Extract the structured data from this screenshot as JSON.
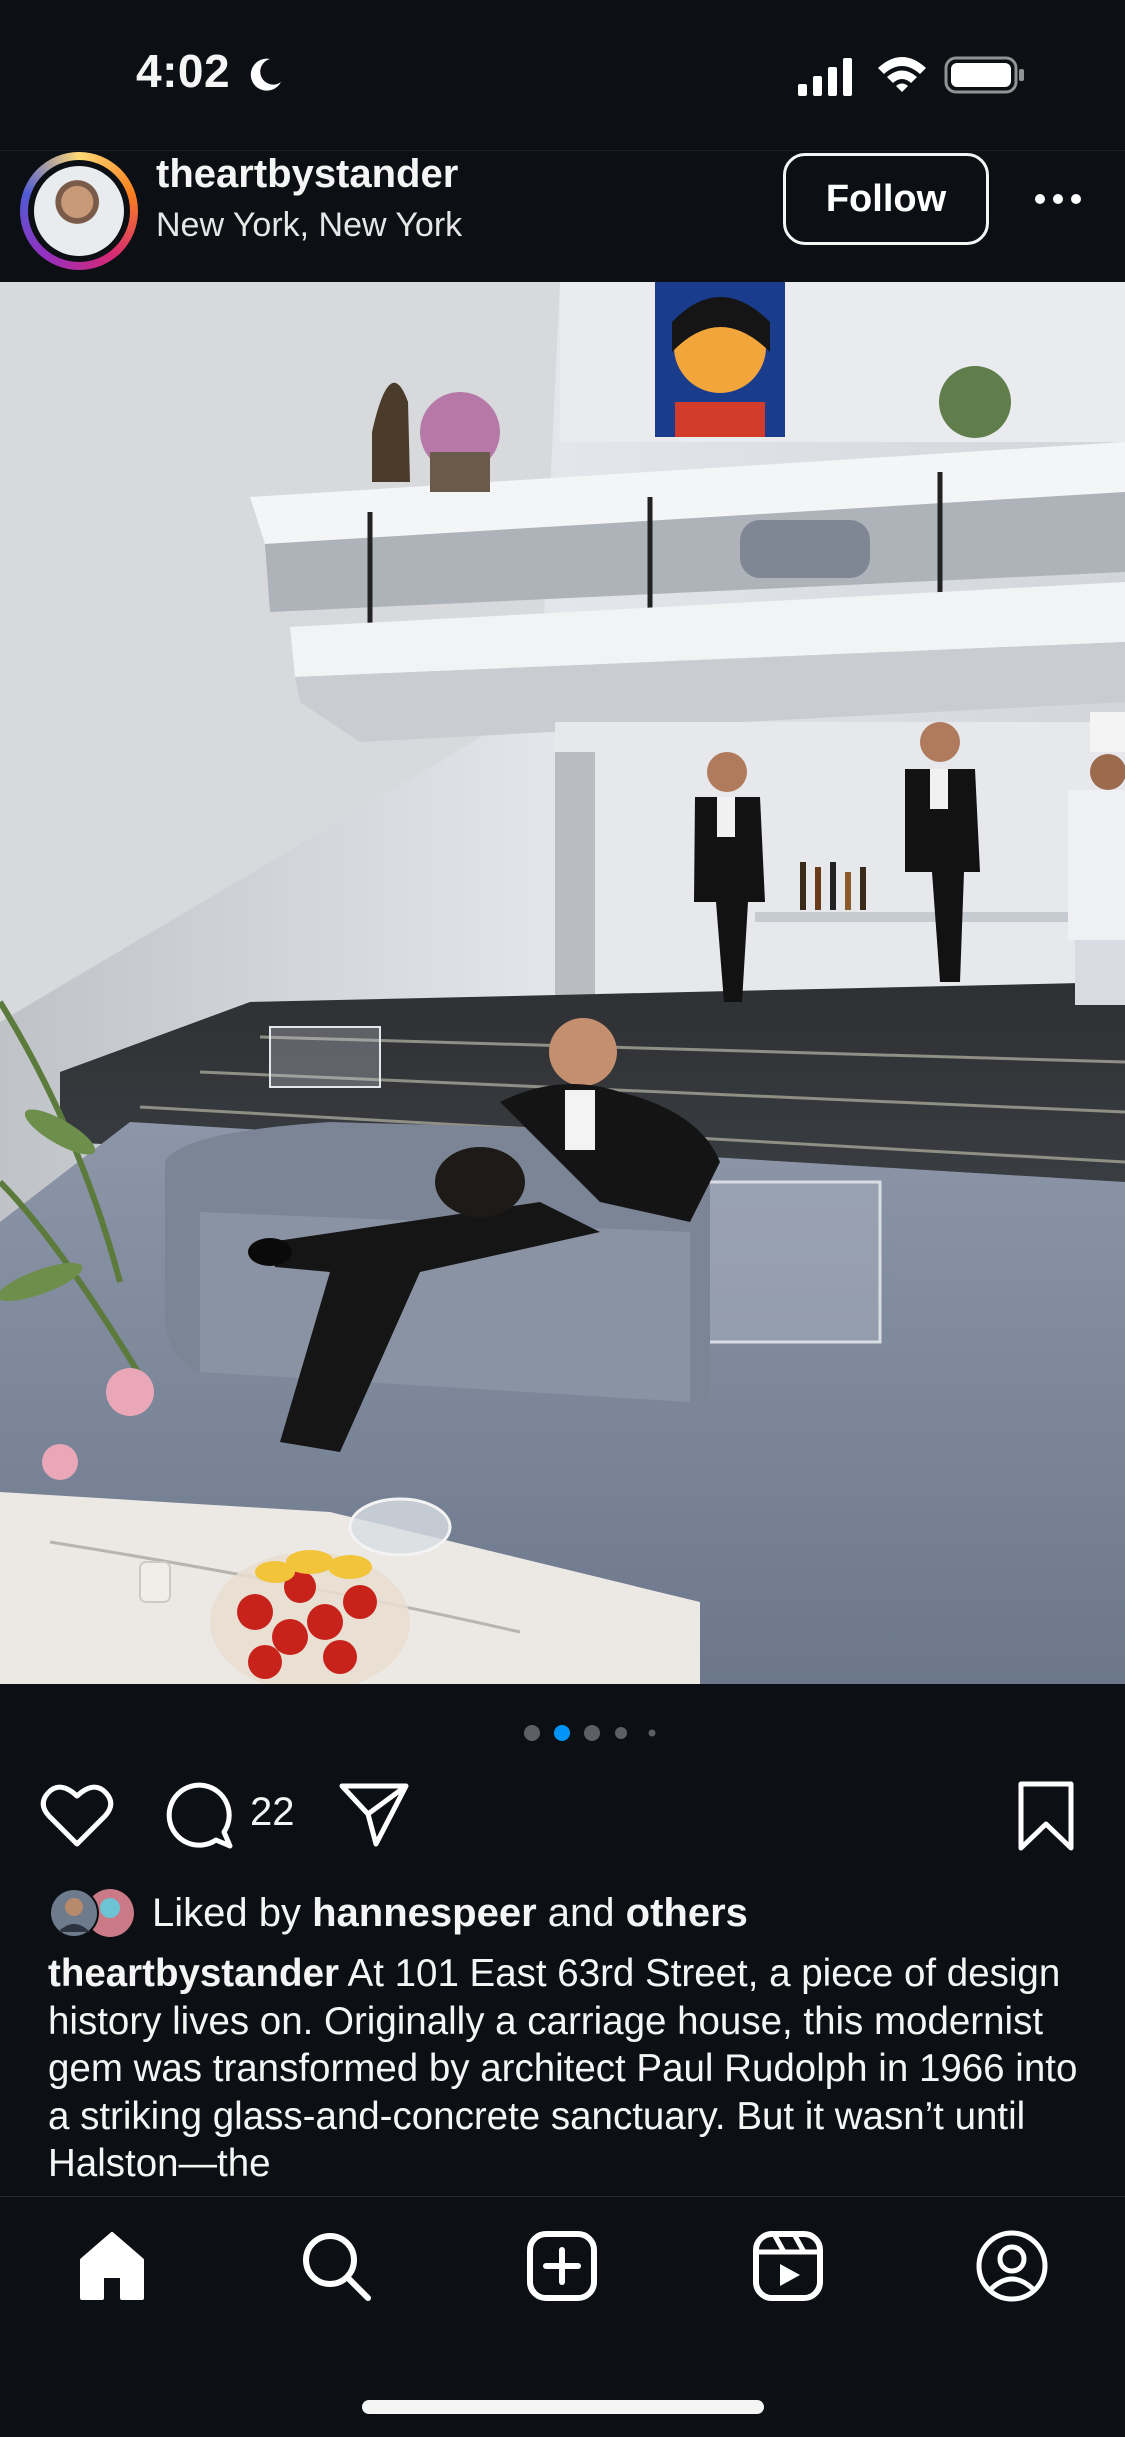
{
  "status": {
    "time": "4:02"
  },
  "post": {
    "username": "theartbystander",
    "location": "New York, New York",
    "follow_label": "Follow",
    "carousel": {
      "count": 5,
      "active_index": 1
    },
    "comment_count": "22",
    "liked_by": {
      "prefix": "Liked by",
      "user": "hannespeer",
      "connector": "and",
      "others": "others"
    },
    "caption": {
      "username": "theartbystander",
      "text": "At 101 East 63rd Street, a piece of design history lives on. Originally a carriage house, this modernist gem was transformed by architect Paul Rudolph in 1966 into a striking glass-and-concrete sanctuary. But it wasn’t until Halston—the"
    }
  },
  "tabs": [
    {
      "name": "home",
      "icon": "home-icon",
      "active": true
    },
    {
      "name": "search",
      "icon": "search-icon"
    },
    {
      "name": "create",
      "icon": "create-post-icon"
    },
    {
      "name": "reels",
      "icon": "reels-icon"
    },
    {
      "name": "profile",
      "icon": "profile-icon"
    }
  ],
  "colors": {
    "background": "#0c1014",
    "text": "#f5f5f5",
    "dot_active": "#0095f6",
    "dot_inactive": "#5c5f63"
  }
}
